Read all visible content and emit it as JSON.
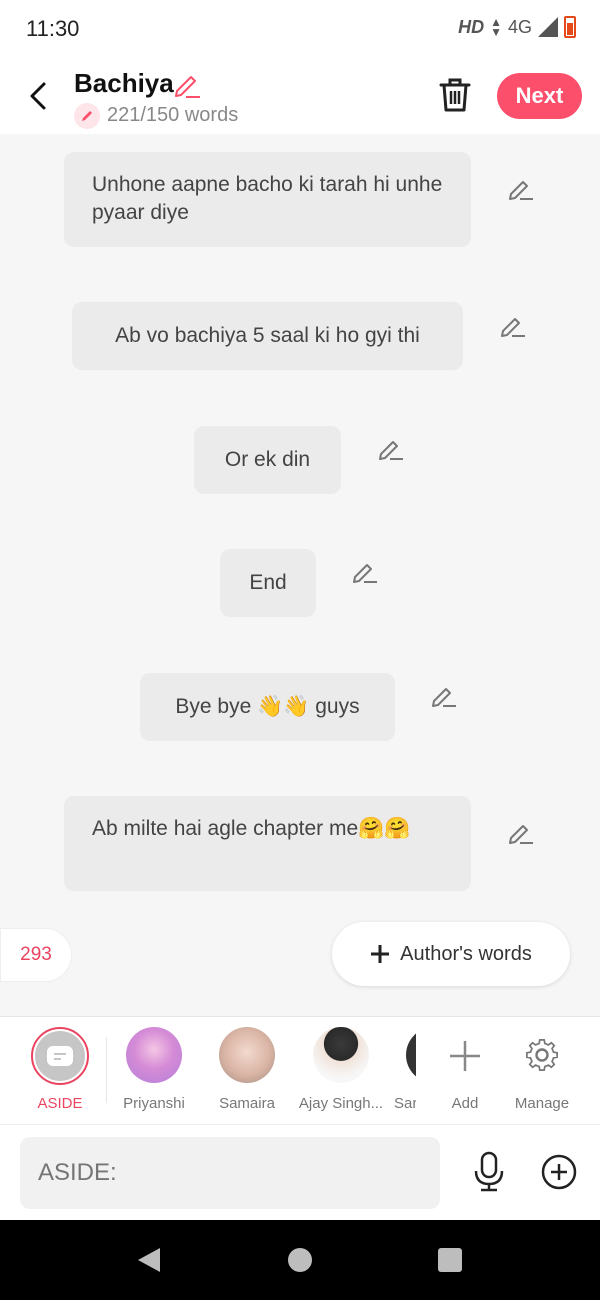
{
  "status_bar": {
    "time": "11:30",
    "hd": "HD",
    "network": "4G"
  },
  "header": {
    "title": "Bachiya",
    "word_count": "221/150 words",
    "next_label": "Next"
  },
  "messages": [
    {
      "text": "Unhone aapne bacho ki tarah hi unhe pyaar diye"
    },
    {
      "text": "Ab vo bachiya 5 saal ki ho gyi thi"
    },
    {
      "text": "Or ek din"
    },
    {
      "text": "End"
    },
    {
      "text": "Bye bye 👋👋 guys"
    },
    {
      "text": "Ab milte hai agle chapter me🤗🤗"
    }
  ],
  "count_badge": "293",
  "author_words": {
    "label": "Author's words"
  },
  "characters": [
    {
      "label": "ASIDE",
      "selected": true
    },
    {
      "label": "Priyanshi"
    },
    {
      "label": "Samaira"
    },
    {
      "label": "Ajay Singh..."
    },
    {
      "label": "Sar"
    },
    {
      "label": "Add"
    },
    {
      "label": "Manage"
    }
  ],
  "input": {
    "placeholder": "ASIDE:"
  },
  "colors": {
    "accent": "#fb4f6b",
    "accent_text": "#e94560",
    "bubble": "#ebebeb",
    "background": "#f6f6f6"
  }
}
